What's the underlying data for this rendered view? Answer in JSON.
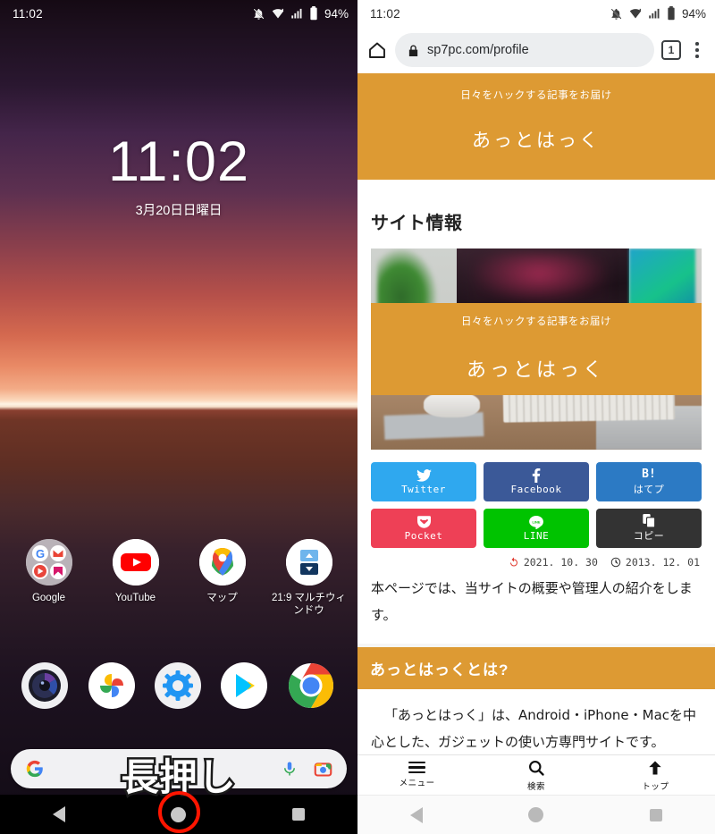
{
  "left_phone": {
    "status_bar": {
      "time": "11:02",
      "battery": "94%",
      "icons": [
        "notifications-off-icon",
        "wifi-icon",
        "signal-icon",
        "battery-icon"
      ]
    },
    "lock_screen": {
      "time": "11:02",
      "date": "3月20日日曜日"
    },
    "apps": [
      {
        "label": "Google",
        "icon": "google-folder-icon"
      },
      {
        "label": "YouTube",
        "icon": "youtube-icon"
      },
      {
        "label": "マップ",
        "icon": "google-maps-icon"
      },
      {
        "label": "21:9 マルチウィンドウ",
        "icon": "multi-window-icon"
      }
    ],
    "dock": [
      {
        "name": "camera-icon"
      },
      {
        "name": "google-photos-icon"
      },
      {
        "name": "settings-icon"
      },
      {
        "name": "play-store-icon"
      },
      {
        "name": "chrome-icon"
      }
    ],
    "search_bar": {
      "google_icon": "google-g-icon",
      "mic_icon": "microphone-icon",
      "lens_icon": "google-lens-icon"
    },
    "annotation": {
      "text": "長押し",
      "highlight_color": "#ff1500"
    },
    "nav_bar": {
      "back": "back-icon",
      "home": "home-icon",
      "recents": "recents-icon"
    }
  },
  "right_phone": {
    "status_bar": {
      "time": "11:02",
      "battery": "94%"
    },
    "browser": {
      "home_icon": "home-icon",
      "lock_icon": "lock-icon",
      "url": "sp7pc.com/profile",
      "tab_count": "1",
      "menu_icon": "kebab-menu-icon"
    },
    "site": {
      "header": {
        "tagline": "日々をハックする記事をお届け",
        "name": "あっとはっく"
      },
      "page_title": "サイト情報",
      "eyecatch": {
        "tagline": "日々をハックする記事をお届け",
        "name": "あっとはっく"
      },
      "share_buttons": [
        {
          "label": "Twitter",
          "icon": "twitter-icon",
          "color": "#2fa8ef"
        },
        {
          "label": "Facebook",
          "icon": "facebook-icon",
          "color": "#3b5998"
        },
        {
          "label": "はてプ",
          "icon": "B!",
          "color": "#2c7ac4"
        },
        {
          "label": "Pocket",
          "icon": "pocket-icon",
          "color": "#ee4056"
        },
        {
          "label": "LINE",
          "icon": "line-icon",
          "color": "#00c300"
        },
        {
          "label": "コピー",
          "icon": "copy-icon",
          "color": "#333333"
        }
      ],
      "dates": {
        "updated_icon": "update-icon",
        "updated": "2021. 10. 30",
        "published_icon": "clock-icon",
        "published": "2013. 12. 01"
      },
      "lede": "本ページでは、当サイトの概要や管理人の紹介をします。",
      "section_heading": "あっとはっくとは?",
      "section_body": "「あっとはっく」は、Android・iPhone・Macを中心とした、ガジェットの使い方専門サイトです。",
      "bottom_nav": [
        {
          "label": "メニュー",
          "icon": "hamburger-icon"
        },
        {
          "label": "検索",
          "icon": "search-icon"
        },
        {
          "label": "トップ",
          "icon": "arrow-up-icon"
        }
      ],
      "accent_color": "#dd9a33"
    },
    "nav_bar": {
      "back": "back-icon",
      "home": "home-icon",
      "recents": "recents-icon"
    }
  }
}
